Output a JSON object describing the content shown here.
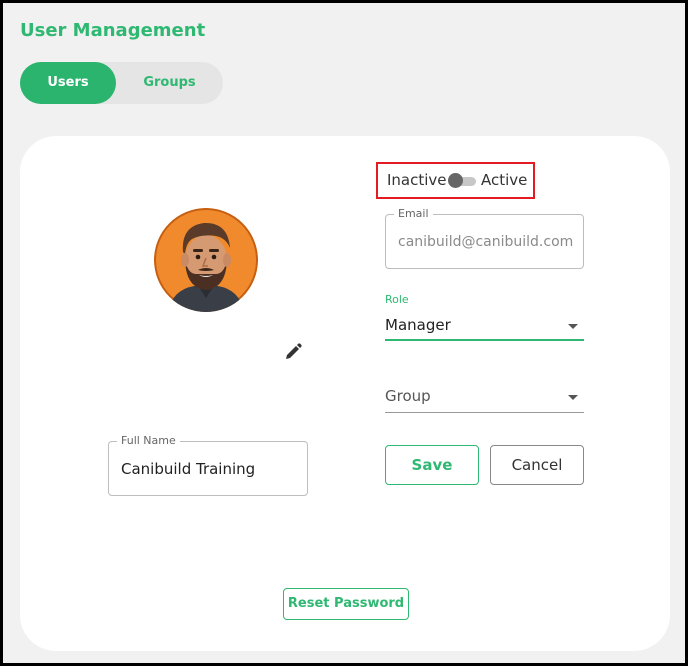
{
  "page": {
    "title": "User Management"
  },
  "tabs": [
    {
      "label": "Users",
      "active": true
    },
    {
      "label": "Groups",
      "active": false
    }
  ],
  "status": {
    "inactive_label": "Inactive",
    "active_label": "Active",
    "is_active": false
  },
  "email": {
    "label": "Email",
    "value": "canibuild@canibuild.com"
  },
  "role": {
    "label": "Role",
    "value": "Manager"
  },
  "group": {
    "placeholder": "Group"
  },
  "full_name": {
    "label": "Full Name",
    "value": "Canibuild Training"
  },
  "buttons": {
    "save": "Save",
    "cancel": "Cancel",
    "reset_password": "Reset Password"
  },
  "colors": {
    "accent": "#2ab46e",
    "highlight": "#e31b23",
    "avatar_bg": "#f08a2c"
  },
  "icons": {
    "avatar": "avatar-illustration",
    "edit": "pencil-icon",
    "dropdown": "caret-down-icon"
  }
}
